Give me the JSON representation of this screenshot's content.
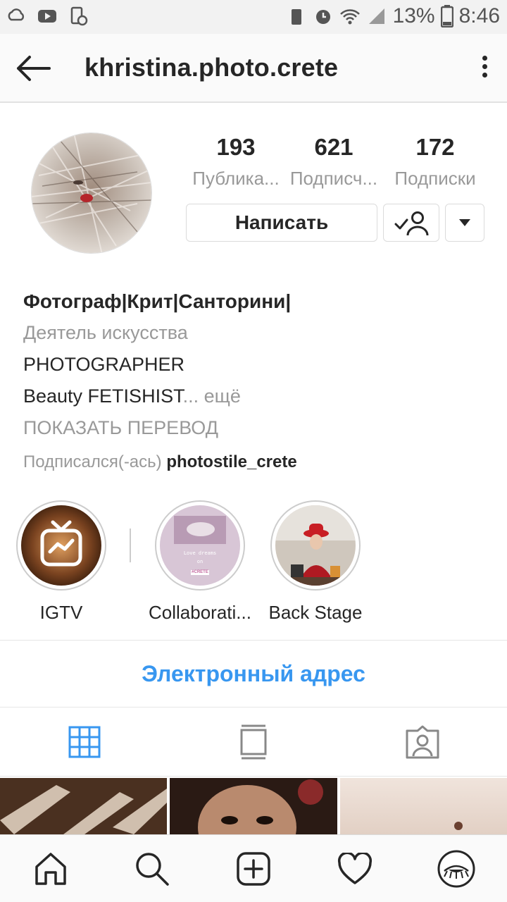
{
  "status_bar": {
    "battery": "13%",
    "time": "8:46"
  },
  "header": {
    "username": "khristina.photo.crete"
  },
  "stats": [
    {
      "value": "193",
      "label": "Публика..."
    },
    {
      "value": "621",
      "label": "Подписч..."
    },
    {
      "value": "172",
      "label": "Подписки"
    }
  ],
  "actions": {
    "message_label": "Написать"
  },
  "bio": {
    "name": "Фотограф|Крит|Санторини|",
    "category": "Деятель искусства",
    "line1": "PHOTOGRAPHER",
    "line2": "Beauty  FETISHIST",
    "more": "... ещё",
    "translate": "ПОКАЗАТЬ ПЕРЕВОД",
    "followed_prefix": "Подписался(-ась)",
    "followed_by": "photostile_crete"
  },
  "highlights": [
    {
      "label": "IGTV"
    },
    {
      "label": "Collaborati..."
    },
    {
      "label": "Back Stage"
    }
  ],
  "highlight_text": {
    "hl2_line1": "Love dreams",
    "hl2_line2": "on",
    "hl2_tag": "#CRETE"
  },
  "contact": {
    "email_label": "Электронный адрес"
  },
  "colors": {
    "accent": "#3897f0",
    "text": "#262626",
    "muted": "#999999"
  }
}
